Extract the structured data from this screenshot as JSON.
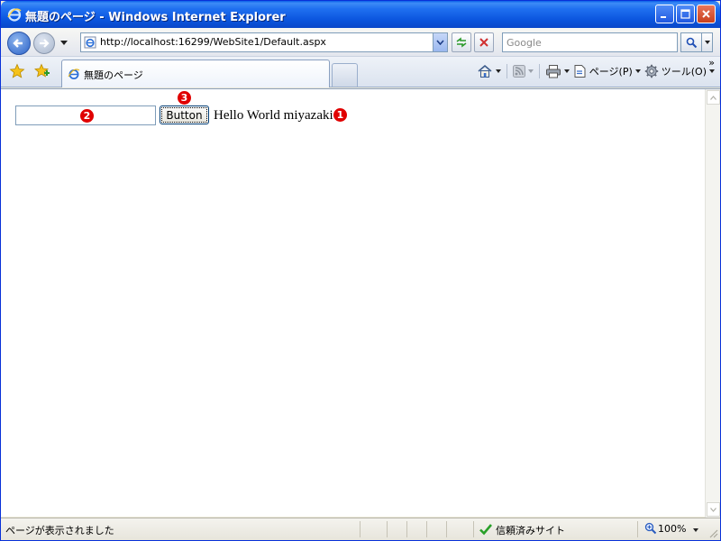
{
  "window": {
    "title": "無題のページ - Windows Internet Explorer"
  },
  "address_bar": {
    "url": "http://localhost:16299/WebSite1/Default.aspx"
  },
  "search": {
    "placeholder": "Google"
  },
  "tab": {
    "label": "無題のページ"
  },
  "command_bar": {
    "page_label": "ページ(P)",
    "tools_label": "ツール(O)",
    "more": "»"
  },
  "page": {
    "textbox_value": "",
    "button_label": "Button",
    "label_text": "Hello World miyazaki"
  },
  "markers": {
    "m1": "1",
    "m2": "2",
    "m3": "3"
  },
  "status": {
    "text": "ページが表示されました",
    "zone": "信頼済みサイト",
    "zoom": "100%"
  },
  "colors": {
    "titlebar": "#0b55de",
    "marker": "#e00000"
  }
}
